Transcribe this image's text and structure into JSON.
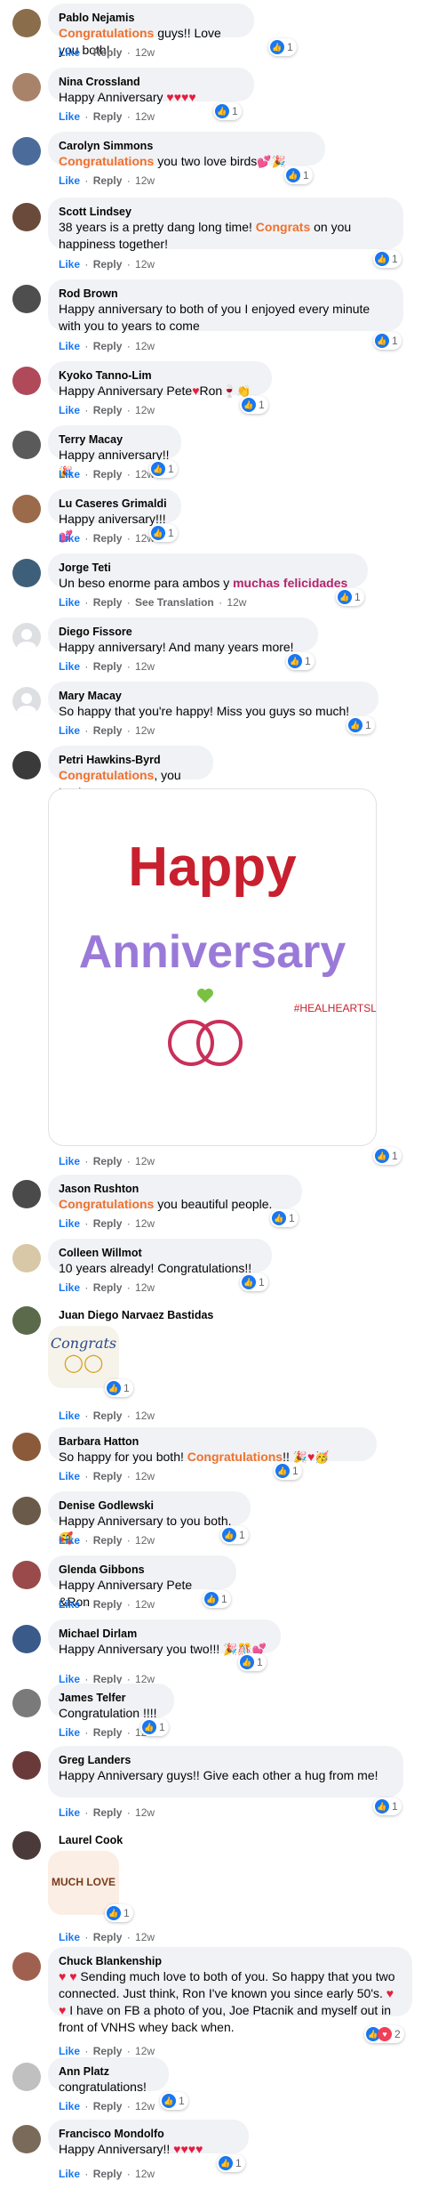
{
  "like_label": "Like",
  "reply_label": "Reply",
  "translation_label": "See Translation",
  "time_label": "12w",
  "colors": {
    "highlight": "#f0712d",
    "highlight_pink": "#b5246b",
    "like_blue": "#1877f2",
    "love_red": "#f33e58"
  },
  "comments": [
    {
      "author": "Pablo Nejamis",
      "segments": [
        {
          "t": "Congratulations",
          "hl": true
        },
        {
          "t": " guys!! Love you both!"
        }
      ],
      "reactions": {
        "icons": [
          "like"
        ],
        "count": "1"
      }
    },
    {
      "author": "Nina Crossland",
      "segments": [
        {
          "t": "Happy Anniversary "
        },
        {
          "t": "♥♥♥♥",
          "heart": true
        }
      ],
      "reactions": {
        "icons": [
          "like"
        ],
        "count": "1"
      }
    },
    {
      "author": "Carolyn Simmons",
      "segments": [
        {
          "t": "Congratulations",
          "hl": true
        },
        {
          "t": " you two love birds"
        },
        {
          "t": "💕🎉",
          "emoji": true
        }
      ],
      "reactions": {
        "icons": [
          "like"
        ],
        "count": "1"
      }
    },
    {
      "author": "Scott Lindsey",
      "segments": [
        {
          "t": "38 years is a pretty dang long time! "
        },
        {
          "t": "Congrats",
          "hl": true
        },
        {
          "t": " on you happiness together!"
        }
      ],
      "reactions": {
        "icons": [
          "like"
        ],
        "count": "1"
      }
    },
    {
      "author": "Rod Brown",
      "segments": [
        {
          "t": "Happy anniversary to both of you I enjoyed every minute with you to years to come"
        }
      ],
      "reactions": {
        "icons": [
          "like"
        ],
        "count": "1"
      }
    },
    {
      "author": "Kyoko Tanno-Lim",
      "segments": [
        {
          "t": "Happy Anniversary Pete"
        },
        {
          "t": "♥",
          "heart": true
        },
        {
          "t": "Ron"
        },
        {
          "t": "🍷👏",
          "emoji": true
        }
      ],
      "reactions": {
        "icons": [
          "like"
        ],
        "count": "1"
      }
    },
    {
      "author": "Terry Macay",
      "segments": [
        {
          "t": "Happy anniversary!!"
        },
        {
          "t": "🎉",
          "emoji": true
        }
      ],
      "reactions": {
        "icons": [
          "like"
        ],
        "count": "1"
      }
    },
    {
      "author": "Lu Caseres Grimaldi",
      "segments": [
        {
          "t": "Happy aniversary!!! "
        },
        {
          "t": "💕",
          "emoji": true
        }
      ],
      "reactions": {
        "icons": [
          "like"
        ],
        "count": "1"
      }
    },
    {
      "author": "Jorge Teti",
      "segments": [
        {
          "t": "Un beso enorme para ambos y "
        },
        {
          "t": "muchas felicidades",
          "hl": true,
          "pink": true
        }
      ],
      "reactions": {
        "icons": [
          "like"
        ],
        "count": "1"
      },
      "translation": true
    },
    {
      "author": "Diego Fissore",
      "segments": [
        {
          "t": "Happy anniversary! And many years more!"
        }
      ],
      "reactions": {
        "icons": [
          "like"
        ],
        "count": "1"
      }
    },
    {
      "author": "Mary Macay",
      "segments": [
        {
          "t": "So happy that you're happy! Miss you guys so much!"
        }
      ],
      "reactions": {
        "icons": [
          "like"
        ],
        "count": "1"
      }
    },
    {
      "author": "Petri Hawkins-Byrd",
      "segments": [
        {
          "t": "Congratulations",
          "hl": true
        },
        {
          "t": ", you two!"
        }
      ],
      "reactions": {
        "icons": [
          "like"
        ],
        "count": "1"
      },
      "image": {
        "line1": "Happy",
        "line2": "Anniversary",
        "tag": "#HEALHEARTSLLC"
      }
    },
    {
      "author": "Jason Rushton",
      "segments": [
        {
          "t": "Congratulations",
          "hl": true
        },
        {
          "t": " you beautiful people."
        }
      ],
      "reactions": {
        "icons": [
          "like"
        ],
        "count": "1"
      }
    },
    {
      "author": "Colleen Willmot",
      "segments": [
        {
          "t": "10 years already! Congratulations!!"
        }
      ],
      "reactions": {
        "icons": [
          "like"
        ],
        "count": "1"
      }
    },
    {
      "author": "Juan Diego Narvaez Bastidas",
      "segments": [],
      "reactions": {
        "icons": [
          "like"
        ],
        "count": "1"
      },
      "sticker": {
        "text": "Congrats"
      }
    },
    {
      "author": "Barbara Hatton",
      "segments": [
        {
          "t": "So happy for you both! "
        },
        {
          "t": "Congratulations",
          "hl": true
        },
        {
          "t": "!! "
        },
        {
          "t": "🎉",
          "emoji": true
        },
        {
          "t": "♥",
          "heart": true
        },
        {
          "t": "🥳",
          "emoji": true
        }
      ],
      "reactions": {
        "icons": [
          "like"
        ],
        "count": "1"
      }
    },
    {
      "author": "Denise Godlewski",
      "segments": [
        {
          "t": "Happy Anniversary to you both. "
        },
        {
          "t": "🥰",
          "emoji": true
        }
      ],
      "reactions": {
        "icons": [
          "like"
        ],
        "count": "1"
      }
    },
    {
      "author": "Glenda Gibbons",
      "segments": [
        {
          "t": "Happy Anniversary Pete &Ron"
        }
      ],
      "reactions": {
        "icons": [
          "like"
        ],
        "count": "1"
      }
    },
    {
      "author": "Michael Dirlam",
      "segments": [
        {
          "t": "Happy Anniversary you two!!! "
        },
        {
          "t": "🎉🎊💕",
          "emoji": true
        }
      ],
      "reactions": {
        "icons": [
          "like"
        ],
        "count": "1"
      }
    },
    {
      "author": "James Telfer",
      "segments": [
        {
          "t": "Congratulation !!!!"
        }
      ],
      "reactions": {
        "icons": [
          "like"
        ],
        "count": "1"
      }
    },
    {
      "author": "Greg Landers",
      "segments": [
        {
          "t": "Happy Anniversary guys!! Give each other a hug from me!"
        }
      ],
      "reactions": {
        "icons": [
          "like"
        ],
        "count": "1"
      }
    },
    {
      "author": "Laurel Cook",
      "segments": [],
      "reactions": {
        "icons": [
          "like"
        ],
        "count": "1"
      },
      "sticker2": {
        "text": "MUCH LOVE"
      }
    },
    {
      "author": "Chuck Blankenship",
      "segments": [
        {
          "t": "♥ ♥",
          "heart": true
        },
        {
          "t": " Sending much love to both of you. So happy that you two connected. Just think, Ron I've known you since early 50's. "
        },
        {
          "t": "♥ ♥",
          "heart": true
        },
        {
          "t": " I have on FB a photo of you, Joe Ptacnik and myself out in front of VNHS whey back when."
        }
      ],
      "reactions": {
        "icons": [
          "like",
          "love"
        ],
        "count": "2"
      }
    },
    {
      "author": "Ann Platz",
      "segments": [
        {
          "t": "congratulations!"
        }
      ],
      "reactions": {
        "icons": [
          "like"
        ],
        "count": "1"
      }
    },
    {
      "author": "Francisco Mondolfo",
      "segments": [
        {
          "t": "Happy Anniversary!! "
        },
        {
          "t": "♥♥♥♥",
          "heart": true
        }
      ],
      "reactions": {
        "icons": [
          "like"
        ],
        "count": "1"
      }
    }
  ]
}
